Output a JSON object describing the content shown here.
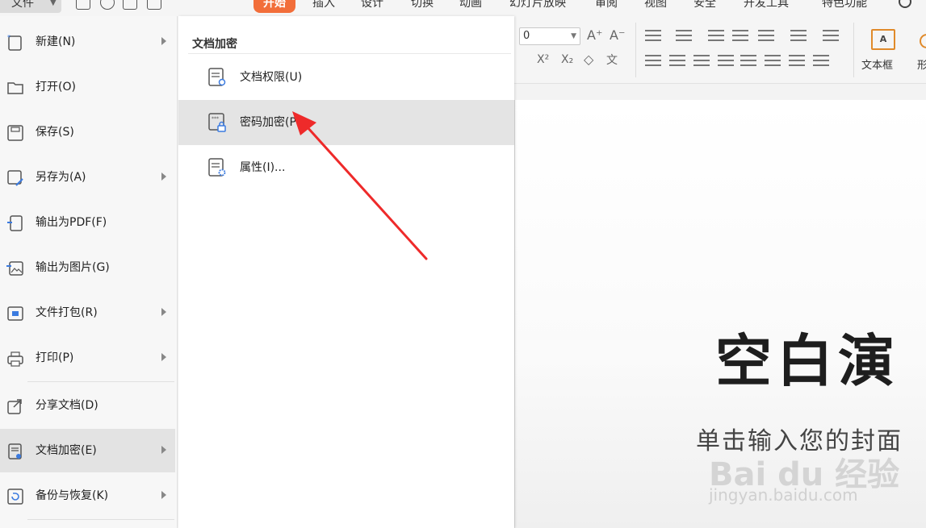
{
  "top_tabs": {
    "file": "文件",
    "home": "开始",
    "insert": "插入",
    "design": "设计",
    "transition": "切换",
    "animation": "动画",
    "slideshow": "幻灯片放映",
    "review": "审阅",
    "view": "视图",
    "security": "安全",
    "devtools": "开发工具",
    "special": "特色功能"
  },
  "ribbon": {
    "font_size_value": "0",
    "textbox_label": "文本框",
    "textbox_icon_text": "A",
    "shape_label": "形"
  },
  "file_menu": {
    "items": [
      {
        "label": "新建(N)"
      },
      {
        "label": "打开(O)"
      },
      {
        "label": "保存(S)"
      },
      {
        "label": "另存为(A)"
      },
      {
        "label": "输出为PDF(F)"
      },
      {
        "label": "输出为图片(G)"
      },
      {
        "label": "文件打包(R)"
      },
      {
        "label": "打印(P)"
      },
      {
        "label": "分享文档(D)"
      },
      {
        "label": "文档加密(E)"
      },
      {
        "label": "备份与恢复(K)"
      }
    ]
  },
  "submenu": {
    "title": "文档加密",
    "items": [
      {
        "label": "文档权限(U)"
      },
      {
        "label": "密码加密(P"
      },
      {
        "label": "属性(I)..."
      }
    ]
  },
  "slide": {
    "title": "空白演",
    "subtitle": "单击输入您的封面"
  },
  "watermark": {
    "brand": "Bai du 经验",
    "url": "jingyan.baidu.com"
  },
  "colors": {
    "accent": "#f26e3a",
    "arrow": "#ee2a2a",
    "menu_selected": "#e3e3e3"
  }
}
